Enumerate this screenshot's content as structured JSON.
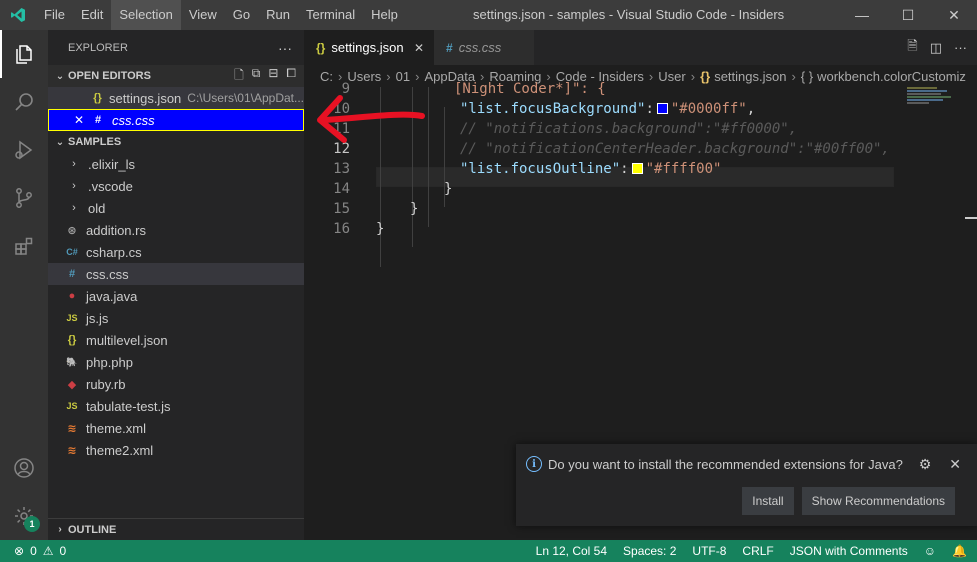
{
  "titlebar": {
    "menu": [
      "File",
      "Edit",
      "Selection",
      "View",
      "Go",
      "Run",
      "Terminal",
      "Help"
    ],
    "active_menu_index": 2,
    "window_title": "settings.json - samples - Visual Studio Code - Insiders",
    "controls": {
      "minimize": "—",
      "maximize": "☐",
      "close": "✕"
    }
  },
  "activitybar": {
    "items": [
      "files-icon",
      "search-icon",
      "run-debug-icon",
      "source-control-icon",
      "extensions-icon"
    ],
    "bottom": [
      "account-icon",
      "manage-gear-icon"
    ],
    "manage_badge": "1"
  },
  "sidebar": {
    "title": "EXPLORER",
    "more": "···",
    "open_editors": {
      "header": "OPEN EDITORS",
      "items": [
        {
          "icon": "{}",
          "name": "settings.json",
          "path": "C:\\Users\\01\\AppDat..."
        },
        {
          "icon": "#",
          "name": "css.css",
          "close": "✕"
        }
      ]
    },
    "samples": {
      "header": "SAMPLES",
      "folders": [
        ".elixir_ls",
        ".vscode",
        "old"
      ],
      "files": [
        {
          "icon": "⊛",
          "name": "addition.rs",
          "color": "#a0a0a0"
        },
        {
          "icon": "C#",
          "name": "csharp.cs",
          "color": "#519aba"
        },
        {
          "icon": "#",
          "name": "css.css",
          "color": "#519aba"
        },
        {
          "icon": "●",
          "name": "java.java",
          "color": "#cc3e44"
        },
        {
          "icon": "JS",
          "name": "js.js",
          "color": "#cbcb41"
        },
        {
          "icon": "{}",
          "name": "multilevel.json",
          "color": "#cbcb41"
        },
        {
          "icon": "🐘",
          "name": "php.php",
          "color": "#a074c4"
        },
        {
          "icon": "◆",
          "name": "ruby.rb",
          "color": "#cc3e44"
        },
        {
          "icon": "JS",
          "name": "tabulate-test.js",
          "color": "#cbcb41"
        },
        {
          "icon": "≋",
          "name": "theme.xml",
          "color": "#e37933"
        },
        {
          "icon": "≋",
          "name": "theme2.xml",
          "color": "#e37933"
        }
      ]
    },
    "outline": "OUTLINE"
  },
  "editor": {
    "tabs": [
      {
        "icon": "{}",
        "label": "settings.json",
        "close": "✕"
      },
      {
        "icon": "#",
        "label": "css.css"
      }
    ],
    "breadcrumb": [
      "C:",
      "Users",
      "01",
      "AppData",
      "Roaming",
      "Code - Insiders",
      "User",
      "settings.json",
      "workbench.colorCustomiz"
    ],
    "breadcrumb_icons": {
      "json": "{}",
      "object": "{ }"
    },
    "lines": {
      "n9": "9",
      "n10": "10",
      "n11": "11",
      "n12": "12",
      "n13": "13",
      "n14": "14",
      "n15": "15",
      "n16": "16",
      "l9": "[Night Coder*]\": {",
      "l10_key": "\"list.focusBackground\"",
      "l10_val": "\"#0000ff\"",
      "l11": "// \"notifications.background\":\"#ff0000\",",
      "l12": "// \"notificationCenterHeader.background\":\"#00ff00\",",
      "l13_key": "\"list.focusOutline\"",
      "l13_val": "\"#ffff00\"",
      "l14": "}",
      "l15": "}",
      "l16": "}",
      "colon": ":",
      "comma": ","
    },
    "swatches": {
      "focus_bg": "#0000ff",
      "focus_outline": "#ffff00"
    }
  },
  "notification": {
    "message": "Do you want to install the recommended extensions for Java?",
    "install": "Install",
    "show_recommendations": "Show Recommendations"
  },
  "statusbar": {
    "errors": "0",
    "warnings": "0",
    "position": "Ln 12, Col 54",
    "spaces": "Spaces: 2",
    "encoding": "UTF-8",
    "eol": "CRLF",
    "language": "JSON with Comments"
  }
}
